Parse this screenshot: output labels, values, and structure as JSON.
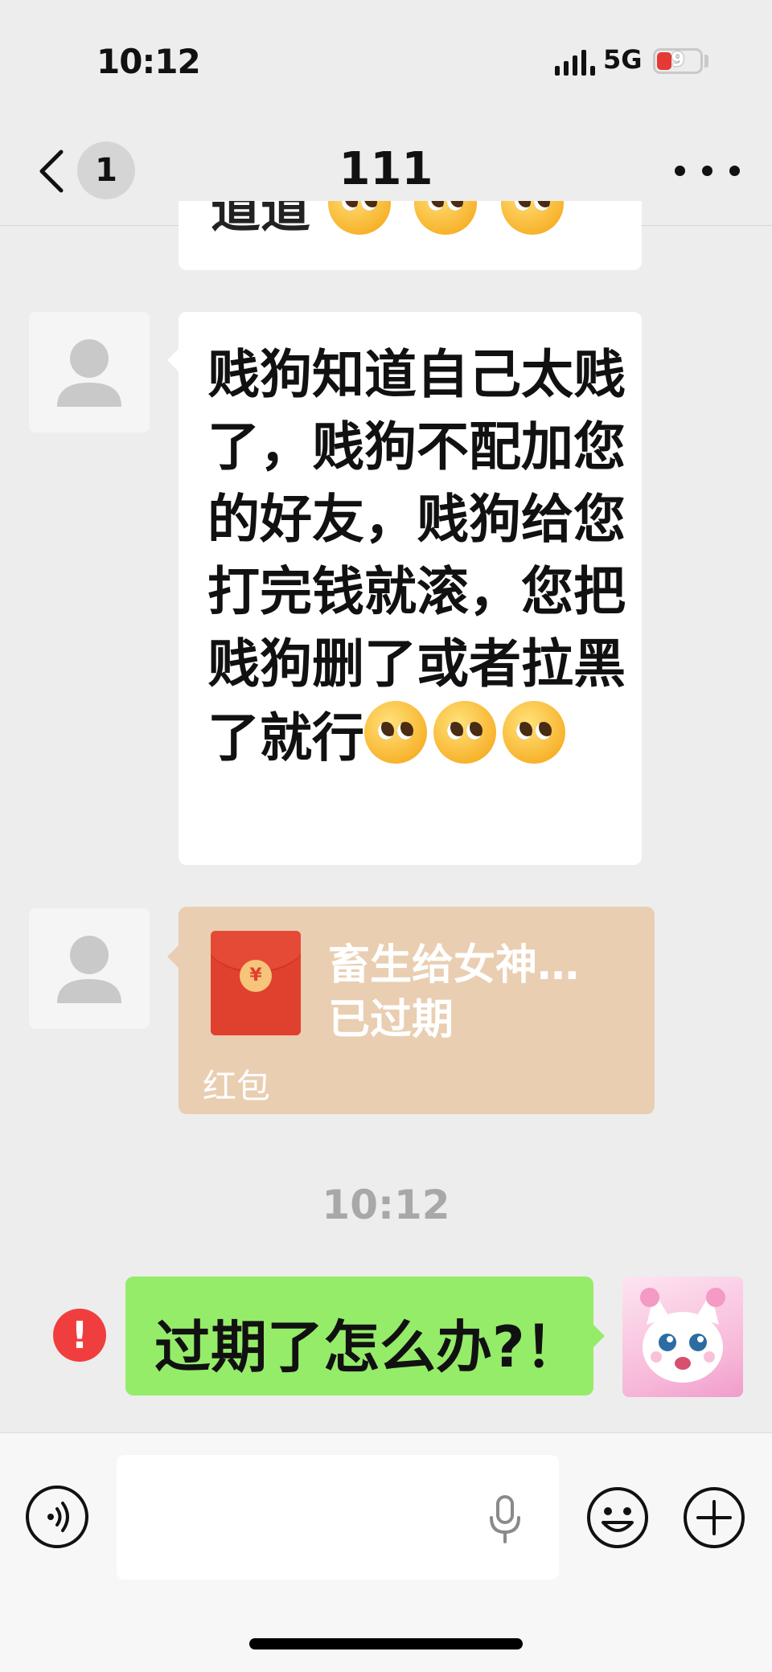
{
  "status_bar": {
    "time": "10:12",
    "network": "5G",
    "battery": "9"
  },
  "nav": {
    "unread_count": "1",
    "title": "111"
  },
  "messages": {
    "previous_fragment": "道道",
    "long_text": "贱狗知道自己太贱了，贱狗不配加您的好友，贱狗给您打完钱就滚，您把贱狗删了或者拉黑了就行",
    "red_packet": {
      "title": "畜生给女神…",
      "status": "已过期",
      "label": "红包",
      "coin_symbol": "¥"
    },
    "timestamp": "10:12",
    "my_message": "过期了怎么办?！",
    "error_mark": "!"
  },
  "input_bar": {
    "placeholder": ""
  },
  "colors": {
    "background": "#ededed",
    "green_bubble": "#95ec69",
    "red_packet_bg": "#e9ceb2",
    "red_packet_icon": "#e0402e",
    "error": "#f03e3e"
  },
  "icons": [
    "back-icon",
    "more-icon",
    "default-avatar-icon",
    "red-packet-icon",
    "error-icon",
    "voice-icon",
    "mic-icon",
    "emoji-icon",
    "plus-icon"
  ]
}
